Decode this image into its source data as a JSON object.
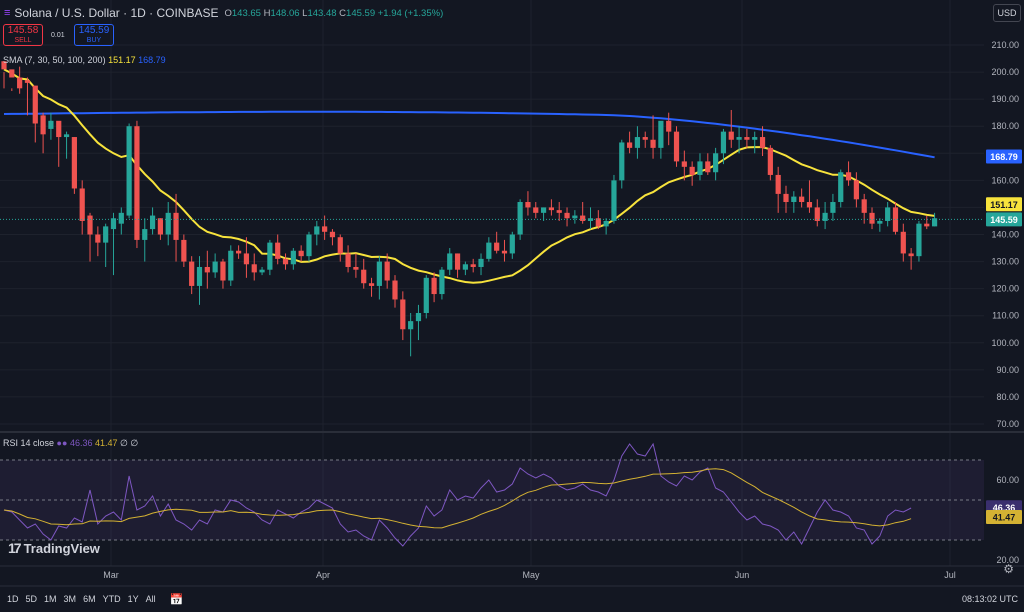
{
  "header": {
    "title": "Solana / U.S. Dollar · 1D · COINBASE",
    "open_label": "O",
    "open": "143.65",
    "high_label": "H",
    "high": "148.06",
    "low_label": "L",
    "low": "143.48",
    "close_label": "C",
    "close": "145.59",
    "change": "+1.94 (+1.35%)"
  },
  "trade": {
    "sell_price": "145.58",
    "sell_label": "SELL",
    "spread": "0.01",
    "buy_price": "145.59",
    "buy_label": "BUY"
  },
  "currency": "USD",
  "sma_legend": {
    "label": "SMA (7, 30, 50, 100, 200)",
    "v1": "151.17",
    "v2": "168.79"
  },
  "rsi_legend": {
    "label": "RSI 14 close",
    "v1": "46.36",
    "v2": "41.47",
    "v3": "∅ ∅"
  },
  "brand": "TradingView",
  "toolbar": {
    "timeframes": [
      "1D",
      "5D",
      "1M",
      "3M",
      "6M",
      "YTD",
      "1Y",
      "All"
    ],
    "clock": "08:13:02 UTC"
  },
  "colors": {
    "background": "#131722",
    "up": "#26a69a",
    "down": "#ef5350",
    "sma_short": "#f7e33c",
    "sma_long": "#2962ff",
    "rsi": "#7e57c2",
    "rsi_ma": "#d4b233"
  },
  "chart_data": [
    {
      "type": "candlestick",
      "title": "Solana / U.S. Dollar · 1D · COINBASE",
      "x_ticks": [
        "Mar",
        "Apr",
        "May",
        "Jun",
        "Jul"
      ],
      "y_ticks": [
        "70.00",
        "80.00",
        "90.00",
        "100.00",
        "110.00",
        "120.00",
        "130.00",
        "140.00",
        "150.00",
        "160.00",
        "170.00",
        "180.00",
        "190.00",
        "200.00",
        "210.00"
      ],
      "ylim": [
        68,
        215
      ],
      "candles": [
        [
          204,
          194,
          200,
          201
        ],
        [
          201,
          194,
          193,
          198
        ],
        [
          198,
          202,
          192,
          194
        ],
        [
          197,
          198,
          184,
          196
        ],
        [
          195,
          194,
          174,
          181
        ],
        [
          184,
          185,
          170,
          177
        ],
        [
          179,
          185,
          175,
          182
        ],
        [
          182,
          181,
          165,
          176
        ],
        [
          176,
          178,
          168,
          177
        ],
        [
          176,
          176,
          155,
          157
        ],
        [
          157,
          160,
          140,
          145
        ],
        [
          147,
          148,
          130,
          140
        ],
        [
          140,
          143,
          132,
          137
        ],
        [
          137,
          144,
          128,
          143
        ],
        [
          142,
          148,
          125,
          146
        ],
        [
          144,
          150,
          140,
          148
        ],
        [
          147,
          181,
          146,
          180
        ],
        [
          180,
          182,
          135,
          138
        ],
        [
          138,
          146,
          130,
          142
        ],
        [
          142,
          150,
          140,
          147
        ],
        [
          146,
          146,
          138,
          140
        ],
        [
          140,
          152,
          136,
          148
        ],
        [
          148,
          155,
          130,
          138
        ],
        [
          138,
          140,
          128,
          130
        ],
        [
          130,
          132,
          118,
          121
        ],
        [
          121,
          132,
          114,
          128
        ],
        [
          128,
          134,
          120,
          126
        ],
        [
          126,
          133,
          124,
          130
        ],
        [
          130,
          131,
          120,
          123
        ],
        [
          123,
          136,
          121,
          134
        ],
        [
          134,
          136,
          131,
          133
        ],
        [
          133,
          139,
          124,
          129
        ],
        [
          129,
          133,
          123,
          126
        ],
        [
          126,
          128,
          125,
          127
        ],
        [
          127,
          138,
          125,
          137
        ],
        [
          137,
          140,
          129,
          131
        ],
        [
          131,
          133,
          127,
          129
        ],
        [
          129,
          135,
          127,
          134
        ],
        [
          134,
          136,
          130,
          132
        ],
        [
          132,
          141,
          130,
          140
        ],
        [
          140,
          145,
          136,
          143
        ],
        [
          143,
          147,
          138,
          141
        ],
        [
          141,
          142,
          136,
          139
        ],
        [
          139,
          140,
          130,
          133
        ],
        [
          133,
          136,
          126,
          128
        ],
        [
          128,
          133,
          124,
          127
        ],
        [
          127,
          131,
          120,
          122
        ],
        [
          122,
          124,
          117,
          121
        ],
        [
          121,
          132,
          116,
          130
        ],
        [
          130,
          133,
          120,
          123
        ],
        [
          123,
          125,
          113,
          116
        ],
        [
          116,
          119,
          101,
          105
        ],
        [
          105,
          111,
          95,
          108
        ],
        [
          108,
          114,
          101,
          111
        ],
        [
          111,
          125,
          109,
          124
        ],
        [
          124,
          126,
          115,
          118
        ],
        [
          118,
          128,
          116,
          127
        ],
        [
          127,
          135,
          125,
          133
        ],
        [
          133,
          133,
          124,
          127
        ],
        [
          127,
          130,
          125,
          129
        ],
        [
          129,
          131,
          126,
          128
        ],
        [
          128,
          133,
          125,
          131
        ],
        [
          131,
          139,
          130,
          137
        ],
        [
          137,
          141,
          133,
          134
        ],
        [
          134,
          138,
          130,
          133
        ],
        [
          133,
          141,
          131,
          140
        ],
        [
          140,
          153,
          138,
          152
        ],
        [
          152,
          156,
          147,
          150
        ],
        [
          150,
          152,
          146,
          148
        ],
        [
          148,
          150,
          145,
          150
        ],
        [
          150,
          153,
          147,
          149
        ],
        [
          149,
          152,
          145,
          148
        ],
        [
          148,
          150,
          143,
          146
        ],
        [
          146,
          149,
          144,
          147
        ],
        [
          147,
          152,
          144,
          145
        ],
        [
          145,
          150,
          142,
          146
        ],
        [
          146,
          149,
          142,
          143
        ],
        [
          143,
          146,
          140,
          145
        ],
        [
          145,
          162,
          144,
          160
        ],
        [
          160,
          175,
          157,
          174
        ],
        [
          174,
          178,
          170,
          172
        ],
        [
          172,
          180,
          168,
          176
        ],
        [
          176,
          178,
          172,
          175
        ],
        [
          175,
          184,
          168,
          172
        ],
        [
          172,
          180,
          168,
          182
        ],
        [
          182,
          185,
          173,
          178
        ],
        [
          178,
          180,
          165,
          167
        ],
        [
          167,
          171,
          160,
          165
        ],
        [
          165,
          167,
          158,
          162
        ],
        [
          162,
          170,
          160,
          167
        ],
        [
          167,
          170,
          162,
          163
        ],
        [
          163,
          172,
          160,
          170
        ],
        [
          170,
          179,
          166,
          178
        ],
        [
          178,
          186,
          172,
          175
        ],
        [
          175,
          180,
          170,
          176
        ],
        [
          176,
          179,
          172,
          175
        ],
        [
          175,
          178,
          170,
          176
        ],
        [
          176,
          180,
          169,
          172
        ],
        [
          172,
          173,
          160,
          162
        ],
        [
          162,
          165,
          148,
          155
        ],
        [
          155,
          158,
          148,
          152
        ],
        [
          152,
          156,
          148,
          154
        ],
        [
          154,
          157,
          150,
          152
        ],
        [
          152,
          160,
          148,
          150
        ],
        [
          150,
          153,
          143,
          145
        ],
        [
          145,
          152,
          142,
          148
        ],
        [
          148,
          155,
          145,
          152
        ],
        [
          152,
          164,
          150,
          163
        ],
        [
          163,
          167,
          158,
          160
        ],
        [
          160,
          163,
          150,
          153
        ],
        [
          153,
          155,
          144,
          148
        ],
        [
          148,
          150,
          142,
          144
        ],
        [
          144,
          146,
          141,
          145
        ],
        [
          145,
          152,
          143,
          150
        ],
        [
          150,
          152,
          140,
          141
        ],
        [
          141,
          144,
          130,
          133
        ],
        [
          133,
          135,
          127,
          132
        ],
        [
          132,
          145,
          130,
          144
        ],
        [
          144,
          147,
          142,
          143
        ],
        [
          143,
          148,
          143,
          146
        ]
      ],
      "series": [
        {
          "name": "SMA",
          "color": "#f7e33c",
          "values_approx": "short moving average",
          "last": 151.17
        },
        {
          "name": "SMA",
          "color": "#2962ff",
          "values_approx": "long moving average",
          "last": 168.79
        }
      ]
    },
    {
      "type": "line",
      "title": "RSI 14 close",
      "y_ticks": [
        "20.00",
        "40.00",
        "60.00"
      ],
      "ylim": [
        18,
        82
      ],
      "bands": [
        30,
        70
      ],
      "series": [
        {
          "name": "RSI",
          "color": "#7e57c2",
          "values": [
            45,
            44,
            40,
            36,
            38,
            33,
            30,
            37,
            36,
            41,
            39,
            55,
            38,
            42,
            44,
            40,
            62,
            45,
            47,
            52,
            42,
            48,
            40,
            38,
            35,
            40,
            38,
            45,
            44,
            50,
            49,
            46,
            44,
            40,
            38,
            45,
            43,
            41,
            44,
            46,
            50,
            48,
            46,
            38,
            34,
            35,
            32,
            30,
            40,
            36,
            31,
            27,
            32,
            36,
            47,
            42,
            45,
            55,
            50,
            52,
            51,
            56,
            60,
            54,
            55,
            58,
            66,
            63,
            61,
            63,
            61,
            57,
            55,
            56,
            58,
            55,
            54,
            52,
            60,
            72,
            78,
            73,
            72,
            78,
            62,
            59,
            57,
            62,
            60,
            64,
            66,
            56,
            54,
            49,
            44,
            40,
            42,
            38,
            37,
            35,
            30,
            34,
            28,
            36,
            44,
            50,
            45,
            44,
            42,
            36,
            35,
            28,
            32,
            42,
            45,
            44,
            46
          ]
        },
        {
          "name": "RSI MA",
          "color": "#d4b233",
          "last": 41.47
        }
      ]
    }
  ]
}
